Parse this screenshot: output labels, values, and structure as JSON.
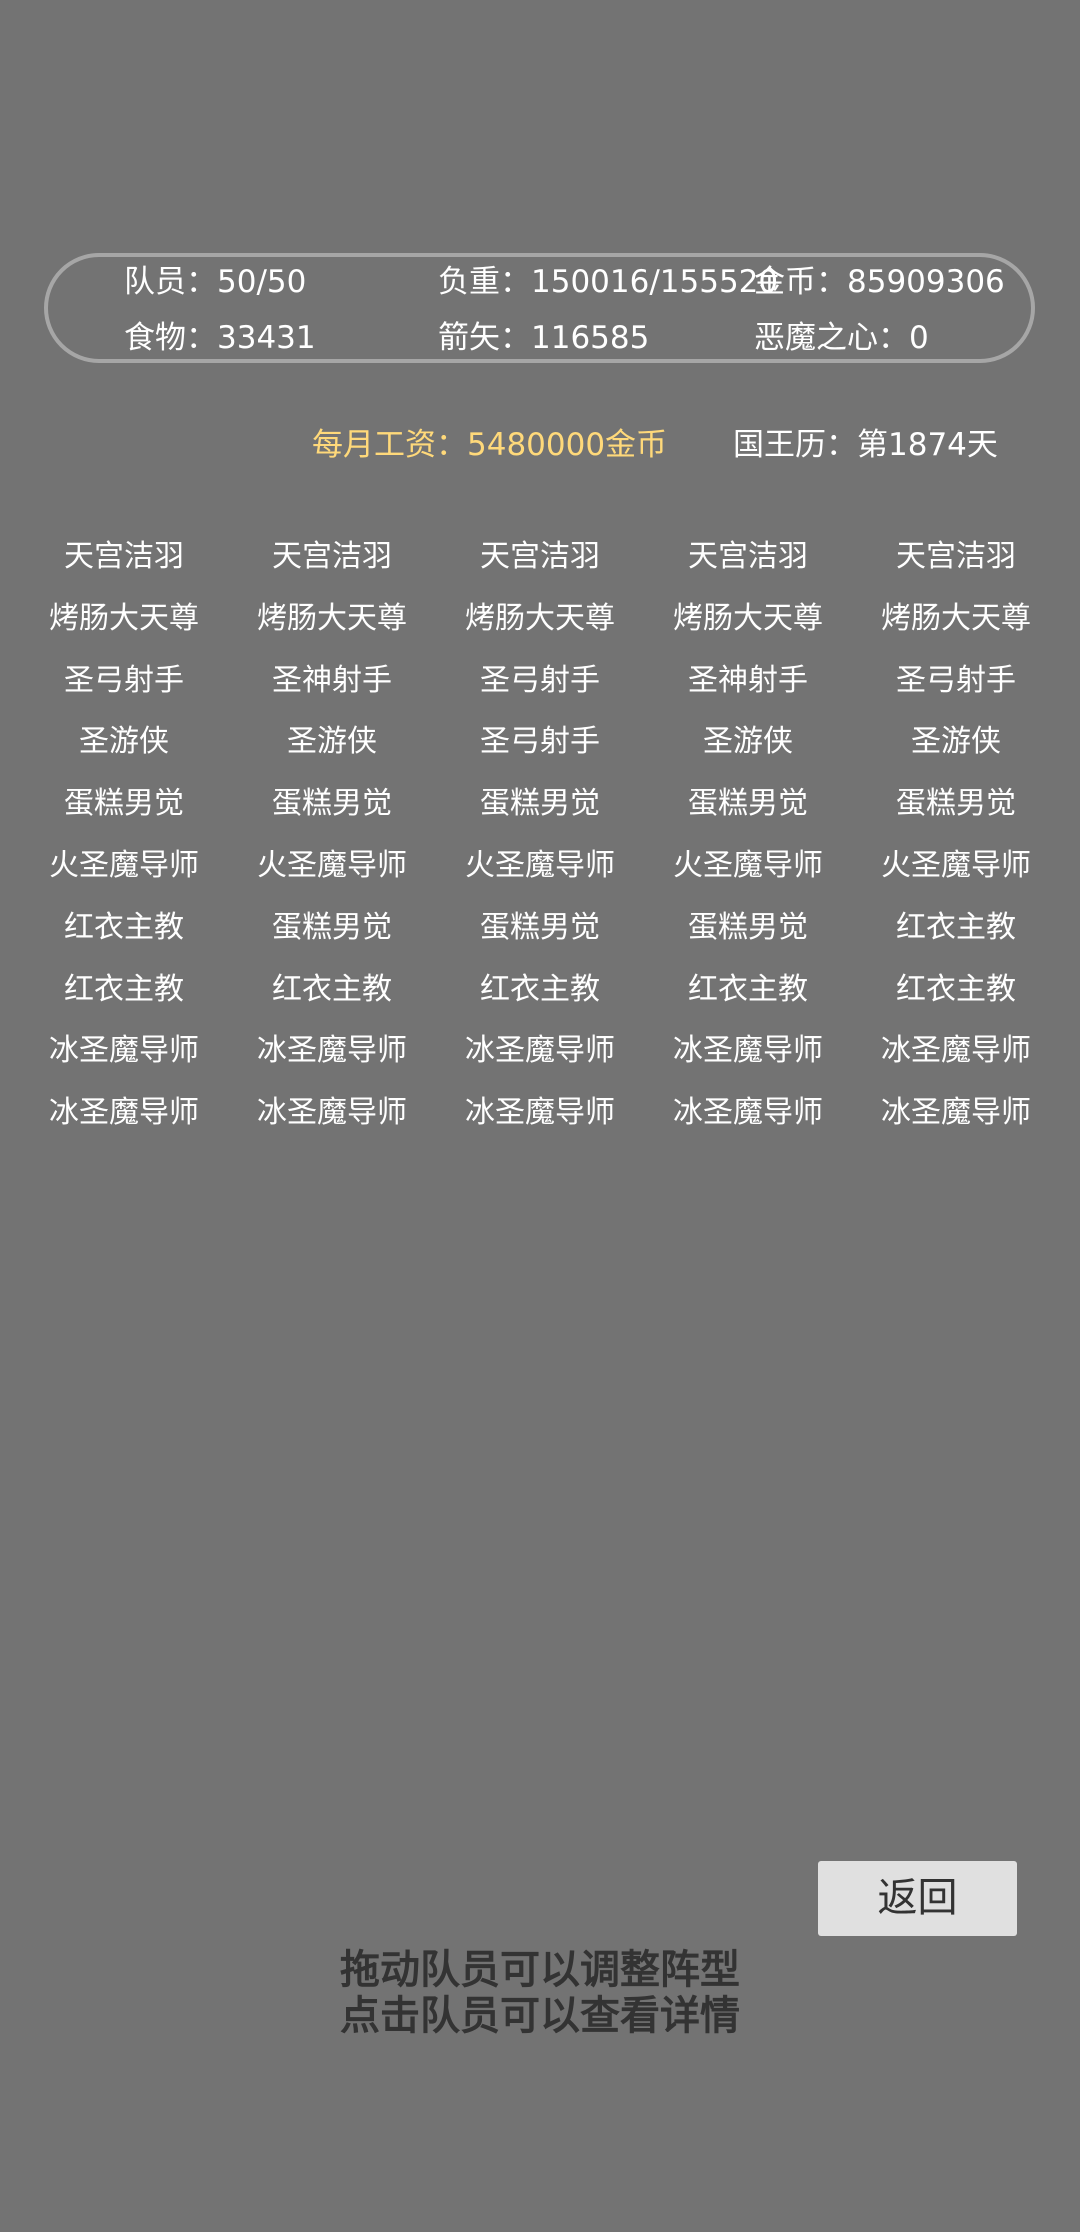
{
  "stats": {
    "members": "队员：50/50",
    "load": "负重：150016/155520",
    "gold": "金币：85909306",
    "food": "食物：33431",
    "arrows": "箭矢：116585",
    "demon_heart": "恶魔之心：0"
  },
  "info": {
    "salary": "每月工资：5480000金币",
    "calendar": "国王历：第1874天"
  },
  "roster": [
    [
      "天宫洁羽",
      "天宫洁羽",
      "天宫洁羽",
      "天宫洁羽",
      "天宫洁羽"
    ],
    [
      "烤肠大天尊",
      "烤肠大天尊",
      "烤肠大天尊",
      "烤肠大天尊",
      "烤肠大天尊"
    ],
    [
      "圣弓射手",
      "圣神射手",
      "圣弓射手",
      "圣神射手",
      "圣弓射手"
    ],
    [
      "圣游侠",
      "圣游侠",
      "圣弓射手",
      "圣游侠",
      "圣游侠"
    ],
    [
      "蛋糕男觉",
      "蛋糕男觉",
      "蛋糕男觉",
      "蛋糕男觉",
      "蛋糕男觉"
    ],
    [
      "火圣魔导师",
      "火圣魔导师",
      "火圣魔导师",
      "火圣魔导师",
      "火圣魔导师"
    ],
    [
      "红衣主教",
      "蛋糕男觉",
      "蛋糕男觉",
      "蛋糕男觉",
      "红衣主教"
    ],
    [
      "红衣主教",
      "红衣主教",
      "红衣主教",
      "红衣主教",
      "红衣主教"
    ],
    [
      "冰圣魔导师",
      "冰圣魔导师",
      "冰圣魔导师",
      "冰圣魔导师",
      "冰圣魔导师"
    ],
    [
      "冰圣魔导师",
      "冰圣魔导师",
      "冰圣魔导师",
      "冰圣魔导师",
      "冰圣魔导师"
    ]
  ],
  "back_label": "返回",
  "hints": {
    "line1": "拖动队员可以调整阵型",
    "line2": "点击队员可以查看详情"
  }
}
